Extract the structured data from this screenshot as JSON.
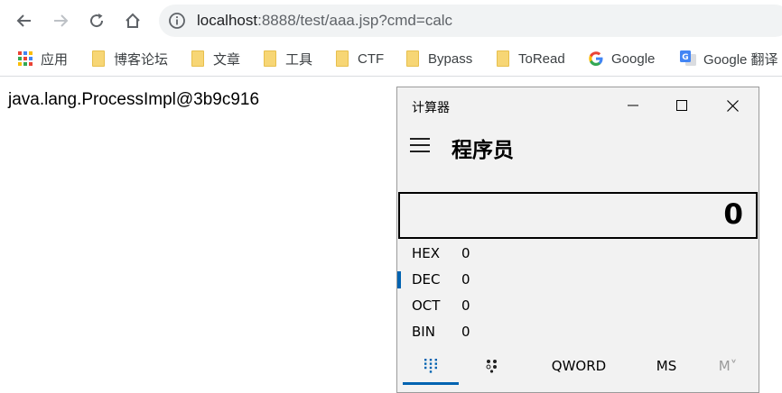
{
  "browser": {
    "url_host": "localhost",
    "url_rest": ":8888/test/aaa.jsp?cmd=calc",
    "bookmarks": [
      {
        "label": "应用",
        "icon": "apps-grid-icon"
      },
      {
        "label": "博客论坛",
        "icon": "folder-icon"
      },
      {
        "label": "文章",
        "icon": "folder-icon"
      },
      {
        "label": "工具",
        "icon": "folder-icon"
      },
      {
        "label": "CTF",
        "icon": "folder-icon"
      },
      {
        "label": "Bypass",
        "icon": "folder-icon"
      },
      {
        "label": "ToRead",
        "icon": "folder-icon"
      },
      {
        "label": "Google",
        "icon": "google-icon"
      },
      {
        "label": "Google 翻译",
        "icon": "google-translate-icon"
      }
    ]
  },
  "page": {
    "output_text": "java.lang.ProcessImpl@3b9c916"
  },
  "calculator": {
    "window_title": "计算器",
    "mode_title": "程序员",
    "display_value": "0",
    "bases": [
      {
        "label": "HEX",
        "value": "0",
        "active": false
      },
      {
        "label": "DEC",
        "value": "0",
        "active": true
      },
      {
        "label": "OCT",
        "value": "0",
        "active": false
      },
      {
        "label": "BIN",
        "value": "0",
        "active": false
      }
    ],
    "tabs": {
      "keypad_icon": "keypad-icon",
      "bit_toggle_icon": "bit-toggle-icon",
      "word_size": "QWORD",
      "memory_store": "MS",
      "memory_menu": "M˅"
    },
    "accent_color": "#0063b1"
  }
}
